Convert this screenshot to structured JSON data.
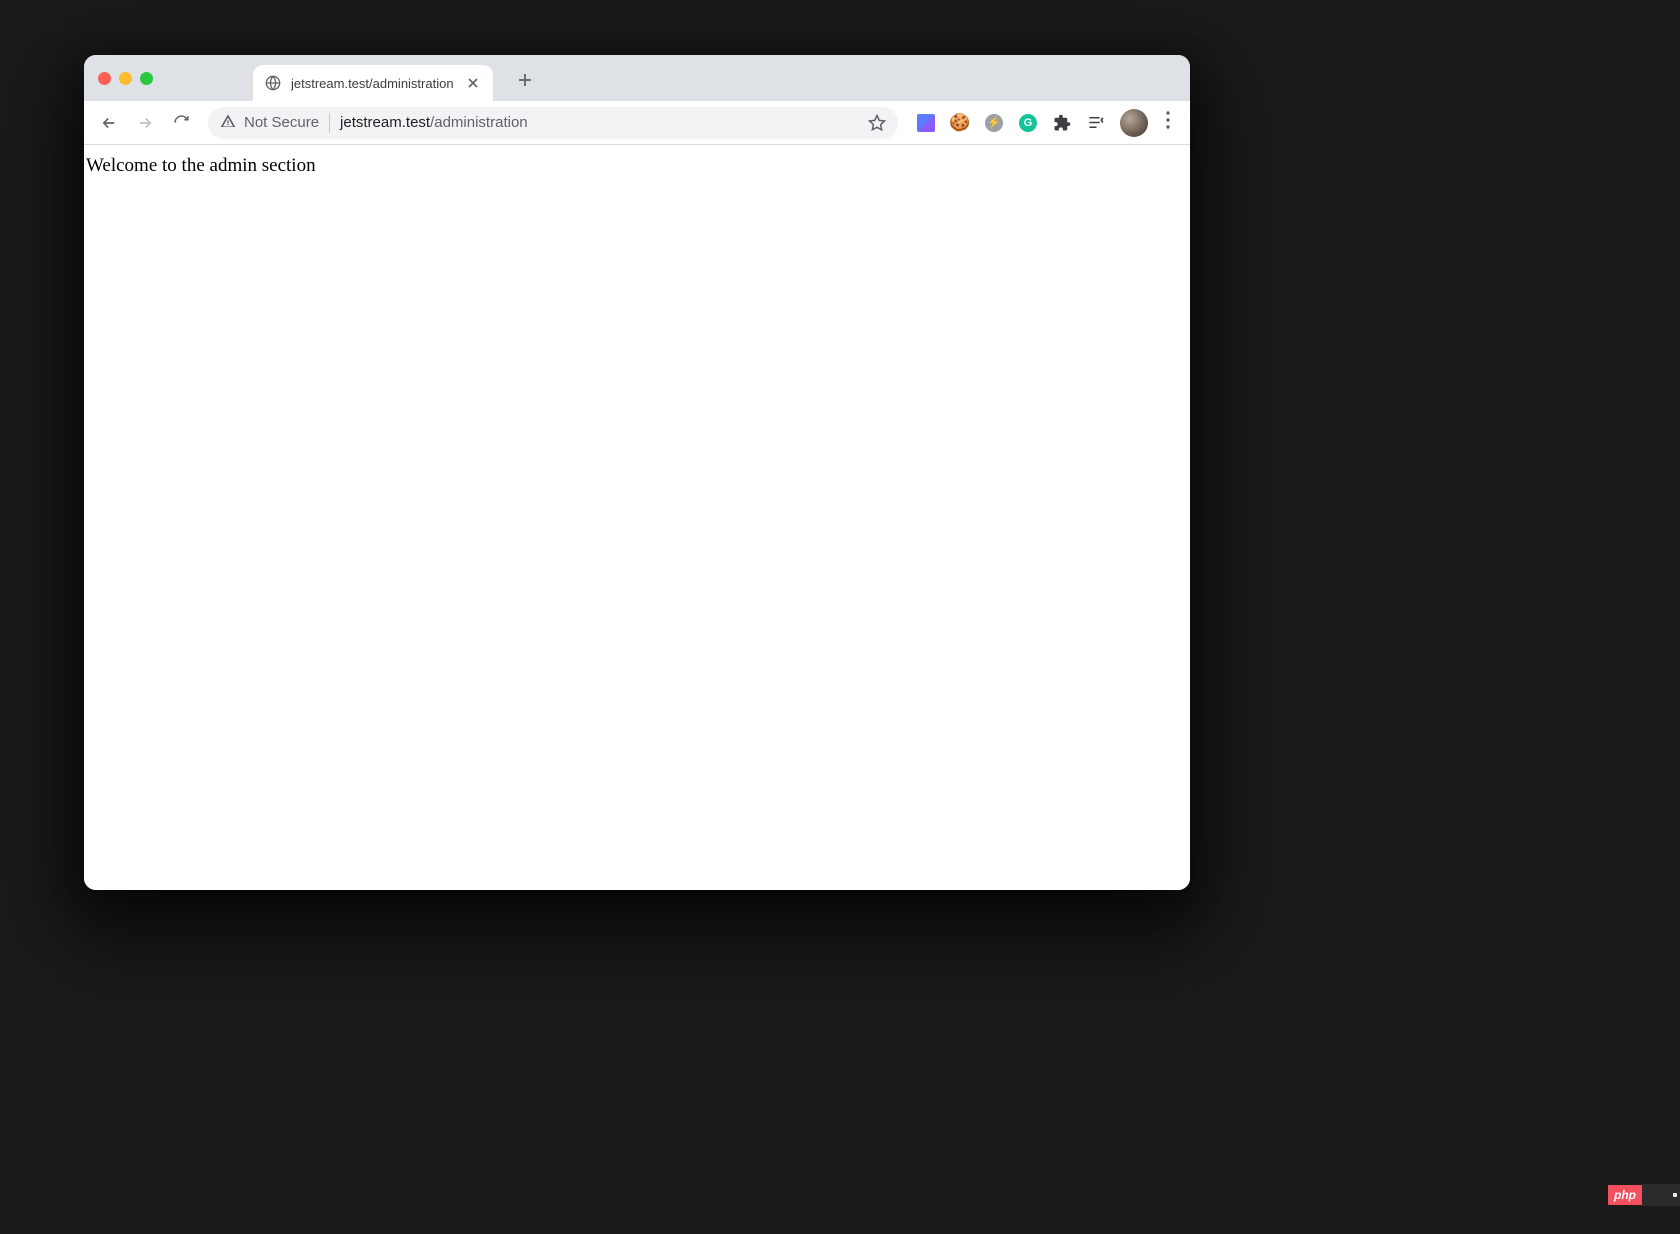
{
  "tab": {
    "title": "jetstream.test/administration",
    "favicon": "globe-icon"
  },
  "toolbar": {
    "security_label": "Not Secure",
    "url_host": "jetstream.test",
    "url_path": "/administration"
  },
  "extensions": {
    "items": [
      "square",
      "cookie",
      "bolt",
      "grammarly",
      "puzzle",
      "reading-list"
    ]
  },
  "page": {
    "body_text": "Welcome to the admin section"
  },
  "watermark": {
    "label": "php"
  }
}
